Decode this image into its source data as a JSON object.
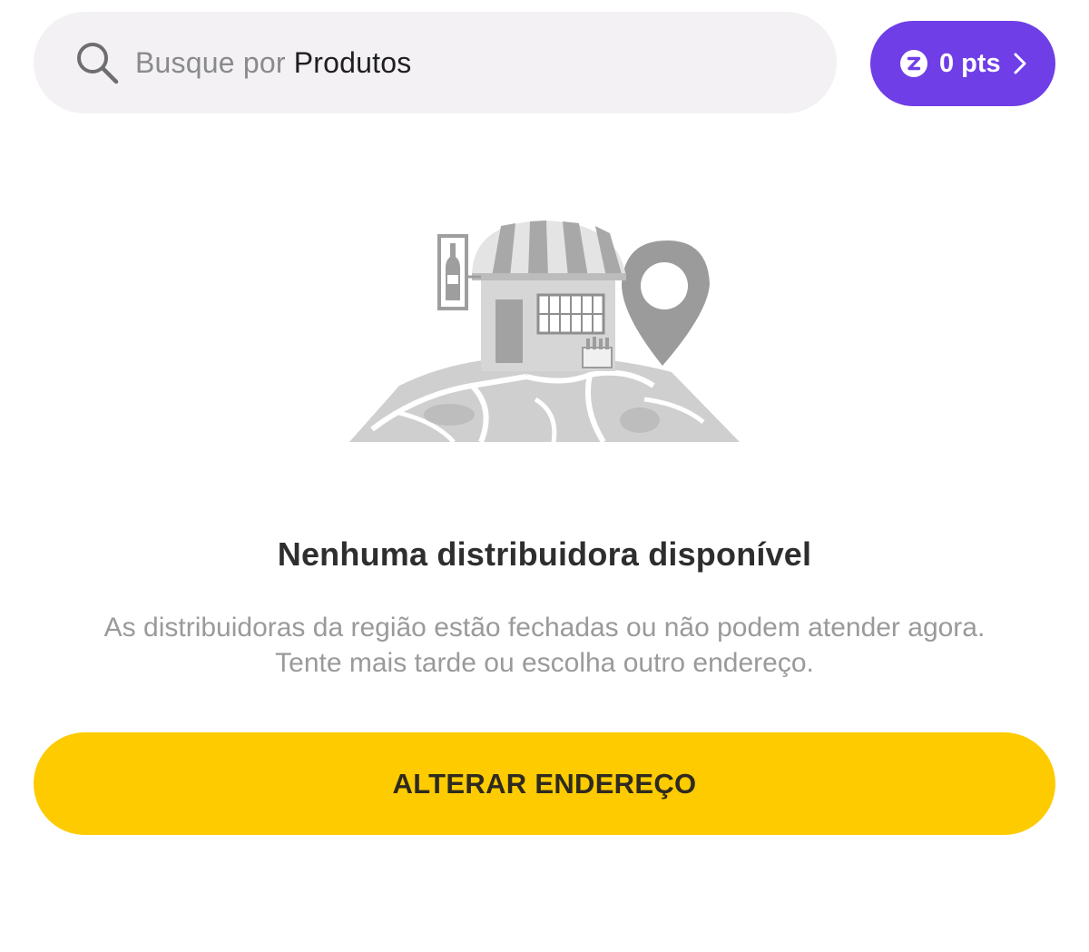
{
  "search": {
    "prefix": "Busque por ",
    "highlight": "Produtos",
    "icon": "search-icon"
  },
  "points": {
    "label": "0 pts",
    "icon": "coin-icon",
    "chevron": "chevron-right-icon",
    "color": "#6f3ee6"
  },
  "illustration": {
    "name": "closed-store-map-illustration"
  },
  "empty_state": {
    "title": "Nenhuma distribuidora disponível",
    "description_line1": "As distribuidoras da região estão fechadas ou não podem atender agora.",
    "description_line2": "Tente mais tarde ou escolha outro endereço."
  },
  "action": {
    "label": "ALTERAR ENDEREÇO",
    "color": "#fdcb00"
  }
}
